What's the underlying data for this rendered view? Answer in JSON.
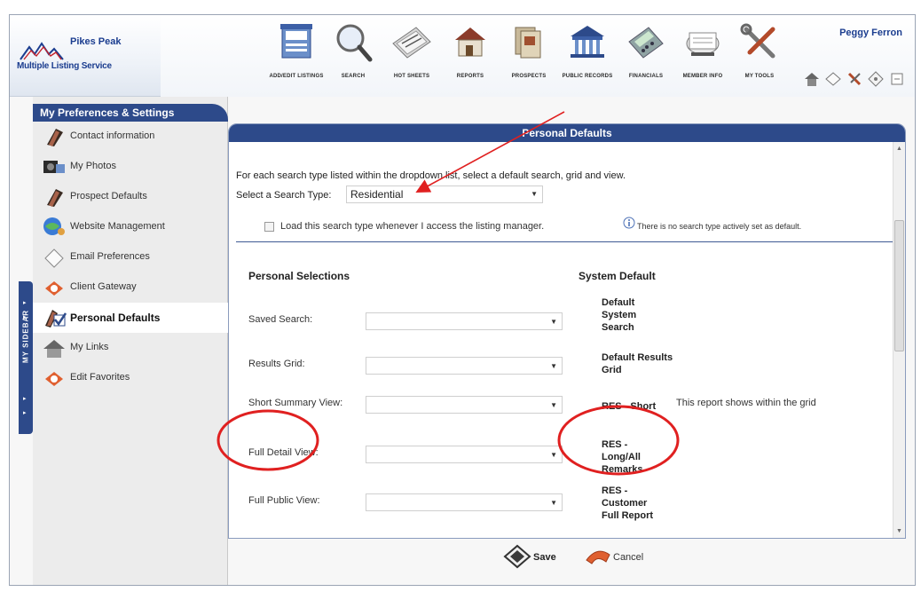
{
  "header": {
    "logo_title": "Pikes Peak",
    "logo_subtitle": "Multiple Listing Service",
    "user_name": "Peggy Ferron",
    "nav": [
      {
        "label": "ADD/EDIT LISTINGS",
        "icon": "add-edit-listings-icon"
      },
      {
        "label": "SEARCH",
        "icon": "magnifier-icon"
      },
      {
        "label": "HOT SHEETS",
        "icon": "hot-sheets-icon"
      },
      {
        "label": "REPORTS",
        "icon": "reports-house-icon"
      },
      {
        "label": "PROSPECTS",
        "icon": "prospects-icon"
      },
      {
        "label": "PUBLIC RECORDS",
        "icon": "public-records-building-icon"
      },
      {
        "label": "FINANCIALS",
        "icon": "calculator-icon"
      },
      {
        "label": "MEMBER INFO",
        "icon": "rolodex-icon"
      },
      {
        "label": "MY TOOLS",
        "icon": "tools-icon"
      }
    ]
  },
  "sidebar": {
    "header": "My Preferences & Settings",
    "tab_label": "MY SIDEBAR",
    "items": [
      {
        "label": "Contact information",
        "icon": "book-icon"
      },
      {
        "label": "My Photos",
        "icon": "camera-icon"
      },
      {
        "label": "Prospect Defaults",
        "icon": "book-icon"
      },
      {
        "label": "Website Management",
        "icon": "globe-people-icon"
      },
      {
        "label": "Email Preferences",
        "icon": "envelope-icon"
      },
      {
        "label": "Client Gateway",
        "icon": "gateway-icon"
      },
      {
        "label": "Personal Defaults",
        "icon": "checkmark-book-icon"
      },
      {
        "label": "My Links",
        "icon": "house-link-icon"
      },
      {
        "label": "Edit Favorites",
        "icon": "favorites-icon"
      }
    ],
    "active_index": 6
  },
  "panel": {
    "title": "Personal Defaults",
    "intro": "For each search type listed within the dropdown list, select a default search, grid and view.",
    "search_type_label": "Select a Search Type:",
    "search_type_value": "Residential",
    "load_label": "Load this search type whenever I access the listing manager.",
    "info_text": "There is no search type actively set as default.",
    "col_personal": "Personal Selections",
    "col_system": "System Default",
    "rows": [
      {
        "label": "Saved Search:",
        "default": "Default System Search",
        "note": ""
      },
      {
        "label": "Results Grid:",
        "default": "Default Results Grid",
        "note": ""
      },
      {
        "label": "Short Summary View:",
        "default": "RES - Short",
        "note": "This report shows within the grid"
      },
      {
        "label": "Full Detail View:",
        "default": "RES - Long/All Remarks",
        "note": ""
      },
      {
        "label": "Full Public View:",
        "default": "RES - Customer Full Report",
        "note": ""
      }
    ]
  },
  "footer": {
    "save_label": "Save",
    "cancel_label": "Cancel"
  },
  "annotations": {
    "color": "#e02020"
  }
}
